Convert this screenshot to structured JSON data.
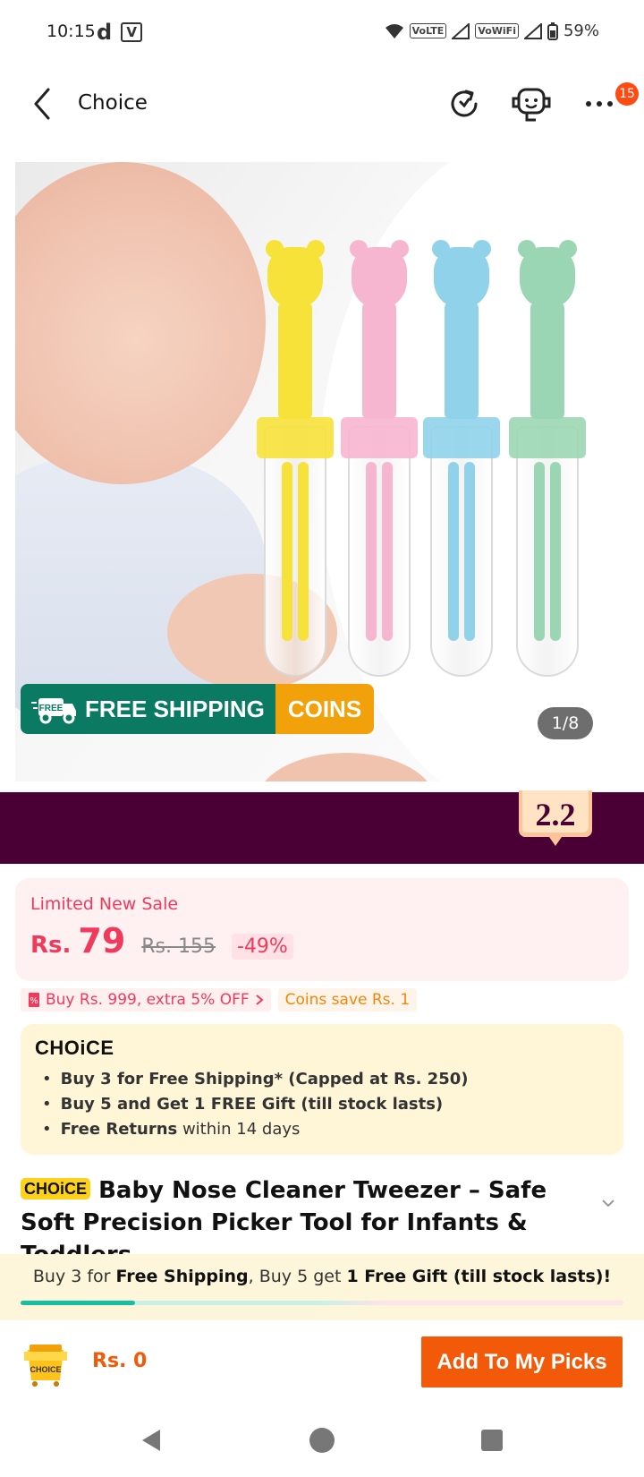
{
  "status_bar": {
    "time": "10:15",
    "app_icon_1": "d",
    "app_icon_2": "V",
    "volte": "VoLTE",
    "vowifi": "VoWiFi",
    "battery": "59%"
  },
  "header": {
    "title": "Choice",
    "notification_count": "15"
  },
  "gallery": {
    "badge_green": "FREE SHIPPING",
    "badge_orange": "COINS",
    "truck_label": "FREE",
    "page_indicator": "1/8"
  },
  "promo": {
    "event": "2.2"
  },
  "price": {
    "label": "Limited New Sale",
    "currency": "Rs.",
    "value": "79",
    "original": "Rs. 155",
    "discount": "-49%"
  },
  "coupons": {
    "extra_off": "Buy Rs. 999, extra 5% OFF",
    "coins": "Coins save Rs. 1"
  },
  "choice_benefits": {
    "logo": "CHOiCE",
    "items": [
      {
        "bold": "Buy 3 for  Free Shipping* (Capped at Rs. 250)",
        "normal": ""
      },
      {
        "bold": "Buy 5 and Get 1 FREE Gift (till stock lasts)",
        "normal": ""
      },
      {
        "bold": "Free Returns",
        "normal": " within 14 days"
      }
    ]
  },
  "product": {
    "pill": "CHOiCE",
    "title": "Baby Nose Cleaner Tweezer – Safe Soft Precision Picker Tool for Infants & Toddlers, ..."
  },
  "shipping_promo": {
    "part1": "Buy 3 for ",
    "bold1": "Free Shipping",
    "part2": ", Buy 5 get ",
    "bold2": "1 Free Gift (till stock lasts)!",
    "progress": 0.19
  },
  "bottom_bar": {
    "cart_label": "CHOICE",
    "total": "Rs. 0",
    "add_button": "Add To My Picks"
  },
  "colors": {
    "accent": "#f25a0a",
    "sale": "#f03a5c",
    "banner": "#4a0035",
    "free_shipping": "#0b7a63",
    "coins": "#f2a10a"
  },
  "tweezer_colors": [
    "#f7e23a",
    "#f7b6cf",
    "#8fd2ea",
    "#9bd6b4"
  ],
  "icons": {
    "back": "chevron-left-icon",
    "history": "history-icon",
    "support": "robot-support-icon",
    "more": "more-dots-icon",
    "truck": "truck-icon",
    "coupon": "coupon-icon",
    "expand": "chevron-down-icon",
    "cart": "choice-cart-icon"
  }
}
